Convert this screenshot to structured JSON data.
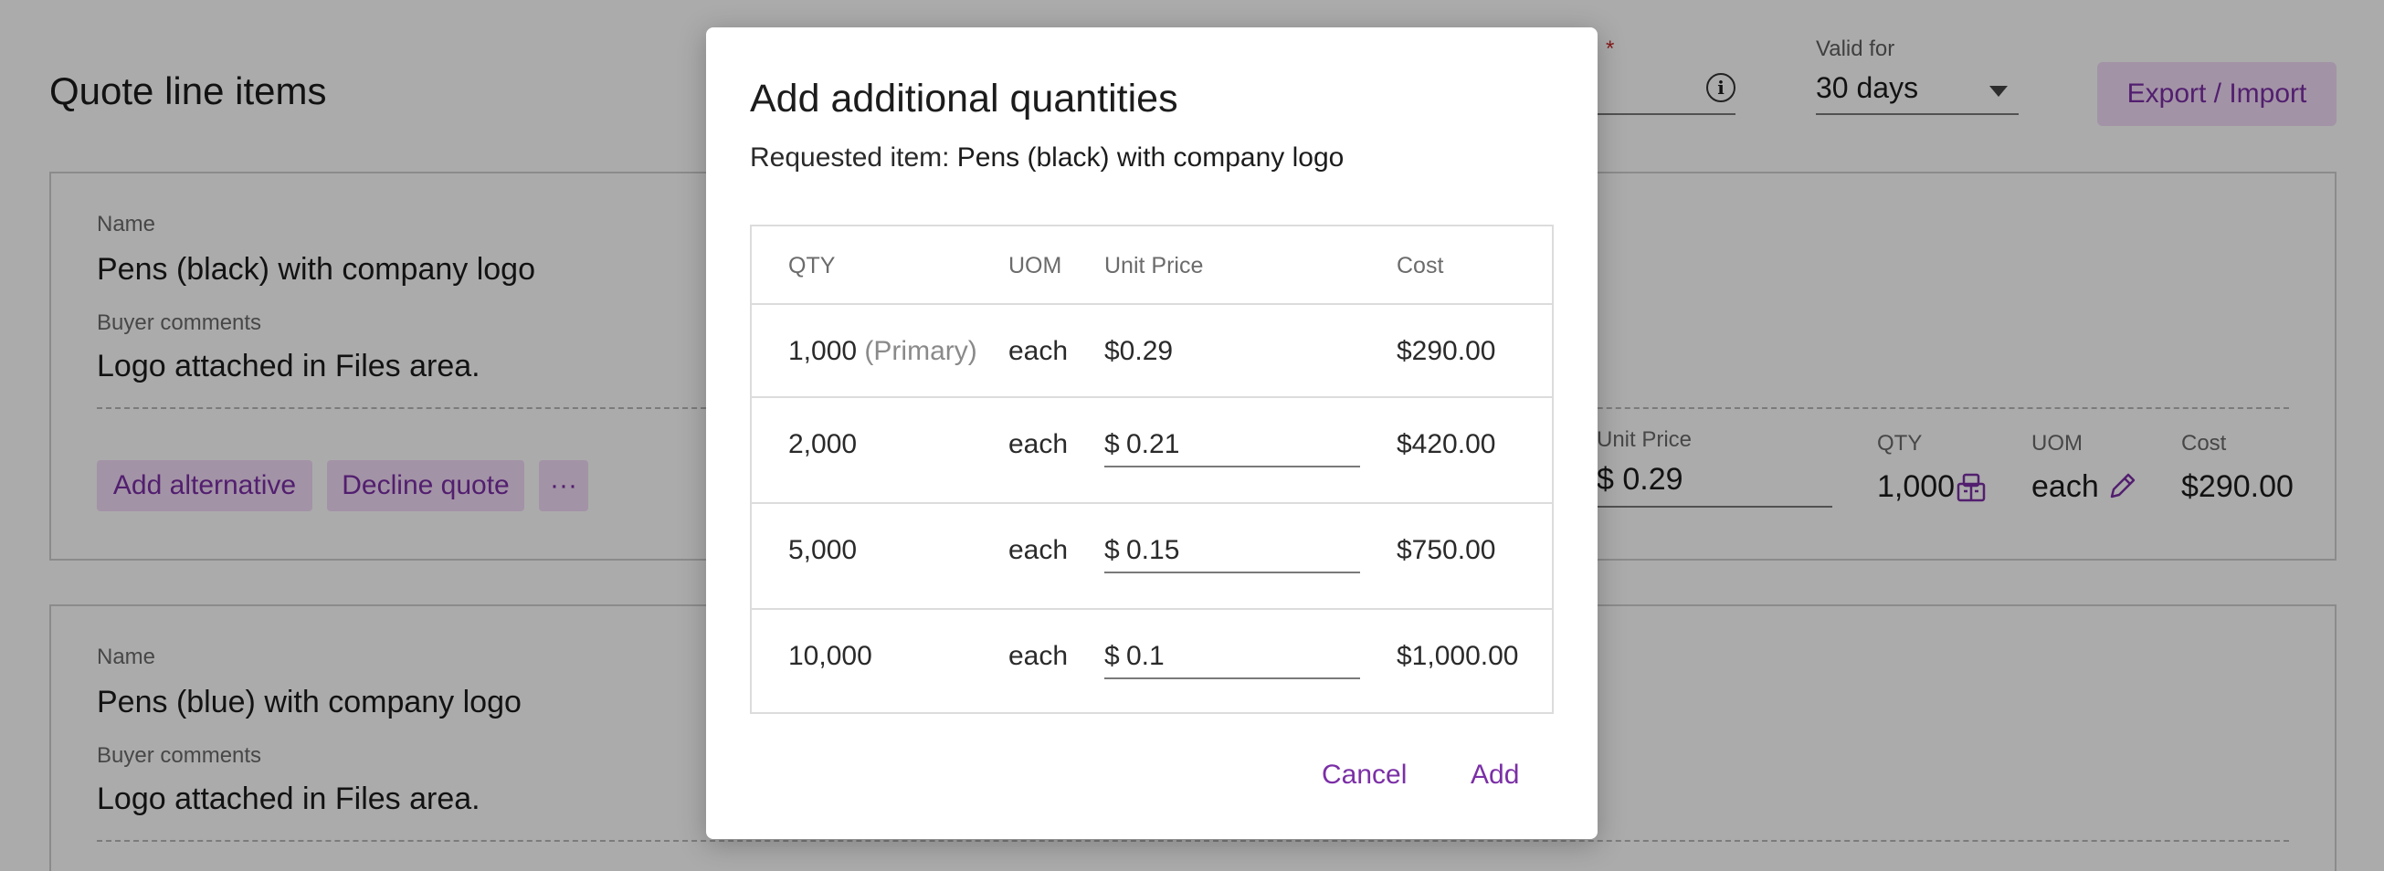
{
  "header": {
    "title": "Quote line items",
    "valid_for_label": "Valid for",
    "valid_for_value": "30 days",
    "required_mark": "*",
    "export_label": "Export / Import"
  },
  "items": [
    {
      "name_label": "Name",
      "name": "Pens (black) with company logo",
      "comments_label": "Buyer comments",
      "comments": "Logo attached in Files area.",
      "actions": {
        "add_alternative": "Add alternative",
        "decline": "Decline quote",
        "more": "···"
      },
      "unit_price_label": "Unit Price",
      "unit_price": "$ 0.29",
      "qty_label": "QTY",
      "qty": "1,000",
      "uom_label": "UOM",
      "uom": "each",
      "cost_label": "Cost",
      "cost": "$290.00"
    },
    {
      "name_label": "Name",
      "name": "Pens (blue) with company logo",
      "comments_label": "Buyer comments",
      "comments": "Logo attached in Files area."
    }
  ],
  "modal": {
    "title": "Add additional quantities",
    "requested_label": "Requested item: ",
    "requested_item": "Pens (black) with company logo",
    "columns": [
      "QTY",
      "UOM",
      "Unit Price",
      "Cost"
    ],
    "primary_row": {
      "qty": "1,000",
      "tag": "(Primary)",
      "uom": "each",
      "unit_price": "$0.29",
      "cost": "$290.00"
    },
    "rows": [
      {
        "qty": "2,000",
        "uom": "each",
        "currency": "$",
        "unit_price": "0.21",
        "cost": "$420.00"
      },
      {
        "qty": "5,000",
        "uom": "each",
        "currency": "$",
        "unit_price": "0.15",
        "cost": "$750.00"
      },
      {
        "qty": "10,000",
        "uom": "each",
        "currency": "$",
        "unit_price": "0.1",
        "cost": "$1,000.00"
      }
    ],
    "cancel_label": "Cancel",
    "add_label": "Add"
  },
  "colors": {
    "accent": "#7b2fa6",
    "accent_bg": "#f3dcf8",
    "overlay": "rgba(0,0,0,0.33)"
  }
}
